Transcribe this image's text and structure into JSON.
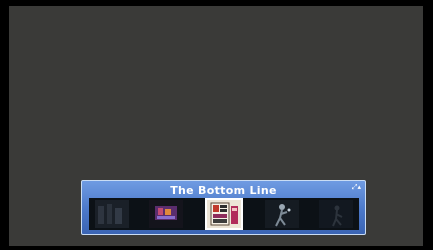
{
  "player": {
    "title": "The Bottom Line",
    "collapse_glyph": "⤢▴",
    "thumbnails": [
      {
        "name": "dark-figures-thumbnail",
        "active": false
      },
      {
        "name": "colorful-stage-thumbnail",
        "active": false
      },
      {
        "name": "selected-pictogram-thumbnail",
        "active": true
      },
      {
        "name": "dancer-thumbnail",
        "active": false
      },
      {
        "name": "silhouette-thumbnail",
        "active": false
      }
    ]
  },
  "colors": {
    "video_background": "#3a3a38",
    "bar_accent": "#5b86d6",
    "selection_border": "#ffffff"
  }
}
